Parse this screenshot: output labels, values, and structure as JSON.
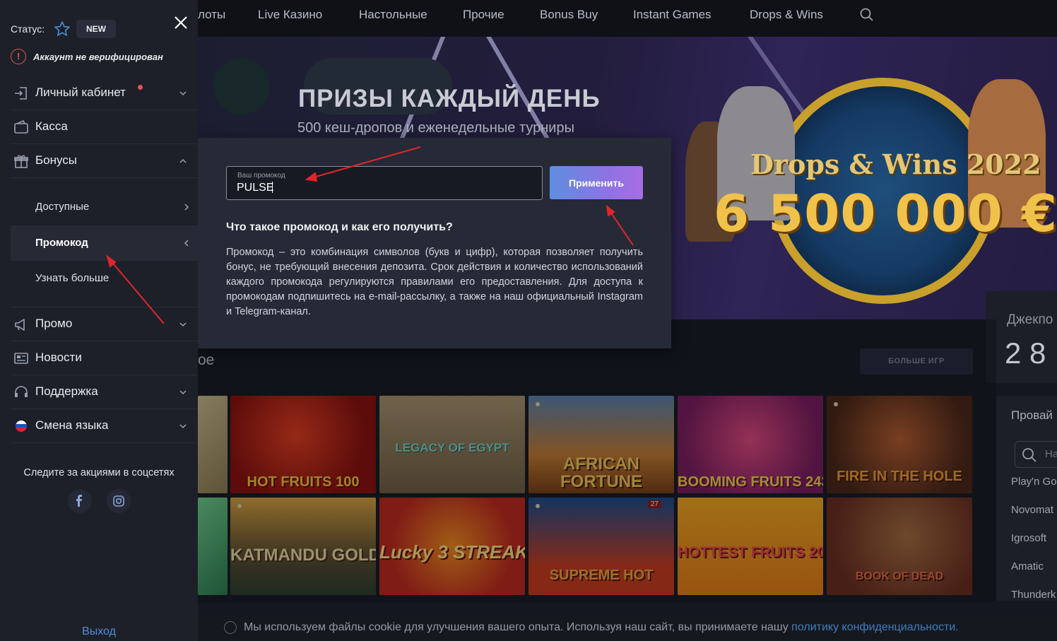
{
  "nav": {
    "items": [
      "лоты",
      "Live Казино",
      "Настольные",
      "Прочие",
      "Bonus Buy",
      "Instant Games",
      "Drops & Wins"
    ],
    "search_icon": "search-icon"
  },
  "hero": {
    "title": "ПРИЗЫ КАЖДЫЙ ДЕНЬ",
    "subtitle": "500 кеш-дропов и еженедельные турниры",
    "banner_title": "Drops & Wins 2022",
    "banner_amount": "6 500 000 €"
  },
  "promo": {
    "field_label": "Ваш промокод",
    "field_value": "PULSE",
    "apply_label": "Применить",
    "question": "Что такое промокод и как его получить?",
    "description": "Промокод – это комбинация символов (букв и цифр), которая позволяет получить бонус, не требующий внесения депозита. Срок действия и количество использований каждого промокода регулируются правилами его предоставления. Для доступа к промокодам подпишитесь на e-mail-рассылку, а также на наш официальный Instagram и Telegram-канал."
  },
  "sidebar": {
    "status_label": "Статус:",
    "status_badge": "NEW",
    "warning": "Аккаунт не верифицирован",
    "menu": [
      {
        "label": "Личный кабинет",
        "icon": "login-icon"
      },
      {
        "label": "Касса",
        "icon": "wallet-icon"
      },
      {
        "label": "Бонусы",
        "icon": "gift-icon"
      },
      {
        "label": "Промо",
        "icon": "megaphone-icon"
      },
      {
        "label": "Новости",
        "icon": "newspaper-icon"
      },
      {
        "label": "Поддержка",
        "icon": "headset-icon"
      },
      {
        "label": "Смена языка",
        "icon": "russia-flag-icon"
      }
    ],
    "bonus_sub": [
      "Доступные",
      "Промокод",
      "Узнать больше"
    ],
    "social_title": "Следите за акциями в соцсетях",
    "logout": "Выход"
  },
  "games": {
    "section_title": "ое",
    "more_button": "БОЛЬШЕ ИГР",
    "row1": [
      "HOT FRUITS 100",
      "LEGACY OF EGYPT",
      "AFRICAN FORTUNE",
      "BOOMING FRUITS 243",
      "FIRE IN THE HOLE"
    ],
    "row2": [
      "KATMANDU GOLD",
      "Lucky 3 STREAK",
      "SUPREME HOT",
      "HOTTEST FRUITS 20",
      "BOOK OF DEAD"
    ],
    "badge_27": "27"
  },
  "jackpot": {
    "label": "Джекпо",
    "value": "2 8"
  },
  "providers": {
    "title": "Провай",
    "search_placeholder": "На",
    "items": [
      "Play'n Go",
      "Novomat",
      "Igrosoft",
      "Amatic",
      "Thunderk"
    ]
  },
  "cookie": {
    "text": "Мы используем файлы cookie для улучшения вашего опыта. Используя наш сайт, вы принимаете нашу ",
    "link": "политику конфиденциальности."
  },
  "colors": {
    "accent_blue": "#4e8fd6",
    "apply_gradient_start": "#5e8ee0",
    "apply_gradient_end": "#a76de4",
    "warning_red": "#e05a4f",
    "annotation_arrow": "#e0262b"
  }
}
